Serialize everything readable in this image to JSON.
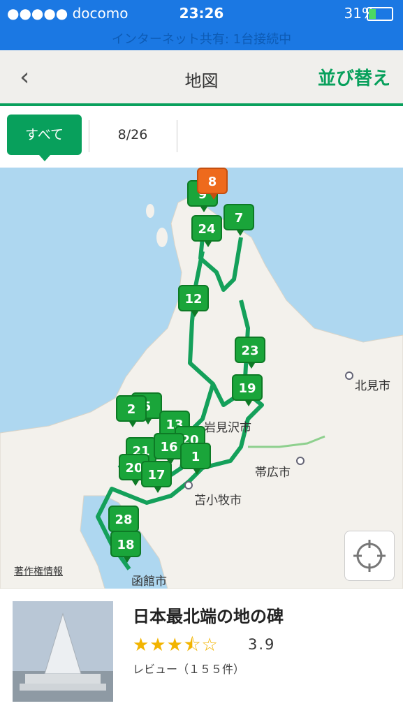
{
  "status_bar": {
    "carrier": "●●●●● docomo",
    "time": "23:26",
    "battery": "31%",
    "hotspot": "インターネット共有: 1台接続中"
  },
  "nav": {
    "back_icon": "chevron-left-icon",
    "title": "地図",
    "sort_label": "並び替え"
  },
  "filter": {
    "all_label": "すべて",
    "count_label": "8/26"
  },
  "map": {
    "labels": {
      "kitami": "北見市",
      "iwamizawa": "岩見沢市",
      "obihiro": "帯広市",
      "tomakomai": "苫小牧市",
      "hakodate": "函館市"
    },
    "copyright": "著作権情報",
    "locate_icon": "crosshair-icon",
    "pins": {
      "p8": "8",
      "p9": "9",
      "p24": "24",
      "p7": "7",
      "p12": "12",
      "p23": "23",
      "p19": "19",
      "p2": "2",
      "p5": "5",
      "p13": "13",
      "p20a": "20",
      "p21": "21",
      "p16": "16",
      "p1": "1",
      "p20": "20",
      "p17": "17",
      "p28": "28",
      "p18": "18"
    },
    "colors": {
      "sea": "#aed7f0",
      "land": "#f3f1ec",
      "route": "#14a05a",
      "pin": "#1aa53a",
      "selected_pin": "#ee6a1c"
    }
  },
  "spot": {
    "name": "日本最北端の地の碑",
    "stars": "★★★⯪☆",
    "rating": "3.9",
    "reviews": "レビュー（１５５件）"
  }
}
